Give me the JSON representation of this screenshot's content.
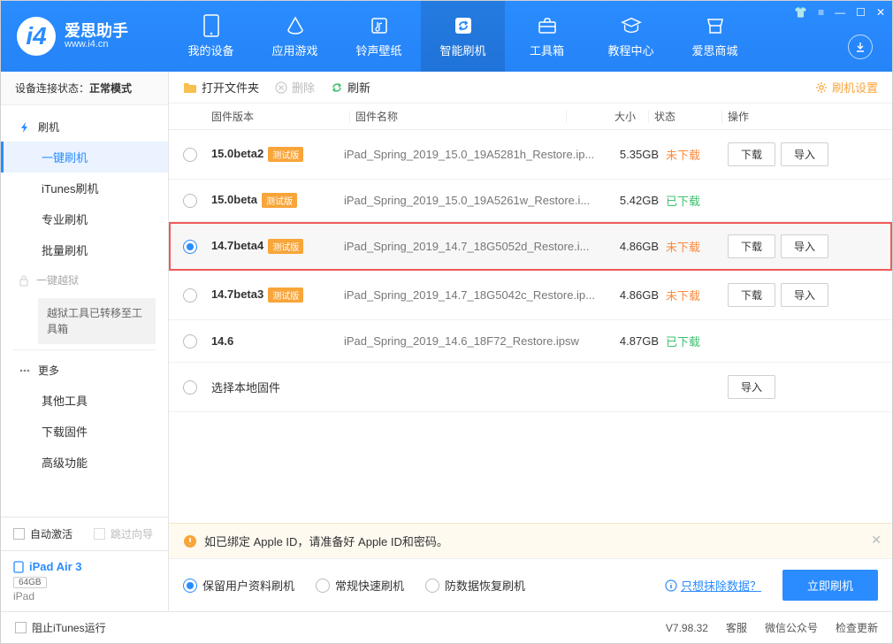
{
  "brand": {
    "name": "爱思助手",
    "url": "www.i4.cn"
  },
  "topnav": [
    {
      "label": "我的设备"
    },
    {
      "label": "应用游戏"
    },
    {
      "label": "铃声壁纸"
    },
    {
      "label": "智能刷机"
    },
    {
      "label": "工具箱"
    },
    {
      "label": "教程中心"
    },
    {
      "label": "爱思商城"
    }
  ],
  "conn_status": {
    "prefix": "设备连接状态：",
    "value": "正常模式"
  },
  "sidebar": {
    "flash_group": "刷机",
    "flash_items": [
      "一键刷机",
      "iTunes刷机",
      "专业刷机",
      "批量刷机"
    ],
    "jailbreak_group": "一键越狱",
    "jailbreak_note": "越狱工具已转移至工具箱",
    "more_group": "更多",
    "more_items": [
      "其他工具",
      "下载固件",
      "高级功能"
    ]
  },
  "sidebar_bottom": {
    "auto_activate": "自动激活",
    "skip_guide": "跳过向导",
    "device_name": "iPad Air 3",
    "device_storage": "64GB",
    "device_type": "iPad",
    "block_itunes": "阻止iTunes运行"
  },
  "toolbar": {
    "open_folder": "打开文件夹",
    "delete": "删除",
    "refresh": "刷新",
    "settings": "刷机设置"
  },
  "table_headers": {
    "version": "固件版本",
    "name": "固件名称",
    "size": "大小",
    "status": "状态",
    "action": "操作"
  },
  "actions": {
    "download": "下载",
    "import": "导入"
  },
  "status_labels": {
    "no": "未下载",
    "yes": "已下载"
  },
  "badge": "测试版",
  "firmware": [
    {
      "ver": "15.0beta2",
      "beta": true,
      "name": "iPad_Spring_2019_15.0_19A5281h_Restore.ip...",
      "size": "5.35GB",
      "downloaded": false,
      "showActions": true
    },
    {
      "ver": "15.0beta",
      "beta": true,
      "name": "iPad_Spring_2019_15.0_19A5261w_Restore.i...",
      "size": "5.42GB",
      "downloaded": true,
      "showActions": false
    },
    {
      "ver": "14.7beta4",
      "beta": true,
      "name": "iPad_Spring_2019_14.7_18G5052d_Restore.i...",
      "size": "4.86GB",
      "downloaded": false,
      "showActions": true,
      "selected": true
    },
    {
      "ver": "14.7beta3",
      "beta": true,
      "name": "iPad_Spring_2019_14.7_18G5042c_Restore.ip...",
      "size": "4.86GB",
      "downloaded": false,
      "showActions": true
    },
    {
      "ver": "14.6",
      "beta": false,
      "name": "iPad_Spring_2019_14.6_18F72_Restore.ipsw",
      "size": "4.87GB",
      "downloaded": true,
      "showActions": false
    }
  ],
  "local_fw": "选择本地固件",
  "notice": "如已绑定 Apple ID，请准备好 Apple ID和密码。",
  "options": {
    "opt1": "保留用户资料刷机",
    "opt2": "常规快速刷机",
    "opt3": "防数据恢复刷机",
    "link": "只想抹除数据？",
    "flash_now": "立即刷机"
  },
  "footer": {
    "version": "V7.98.32",
    "service": "客服",
    "wechat": "微信公众号",
    "check_update": "检查更新"
  }
}
